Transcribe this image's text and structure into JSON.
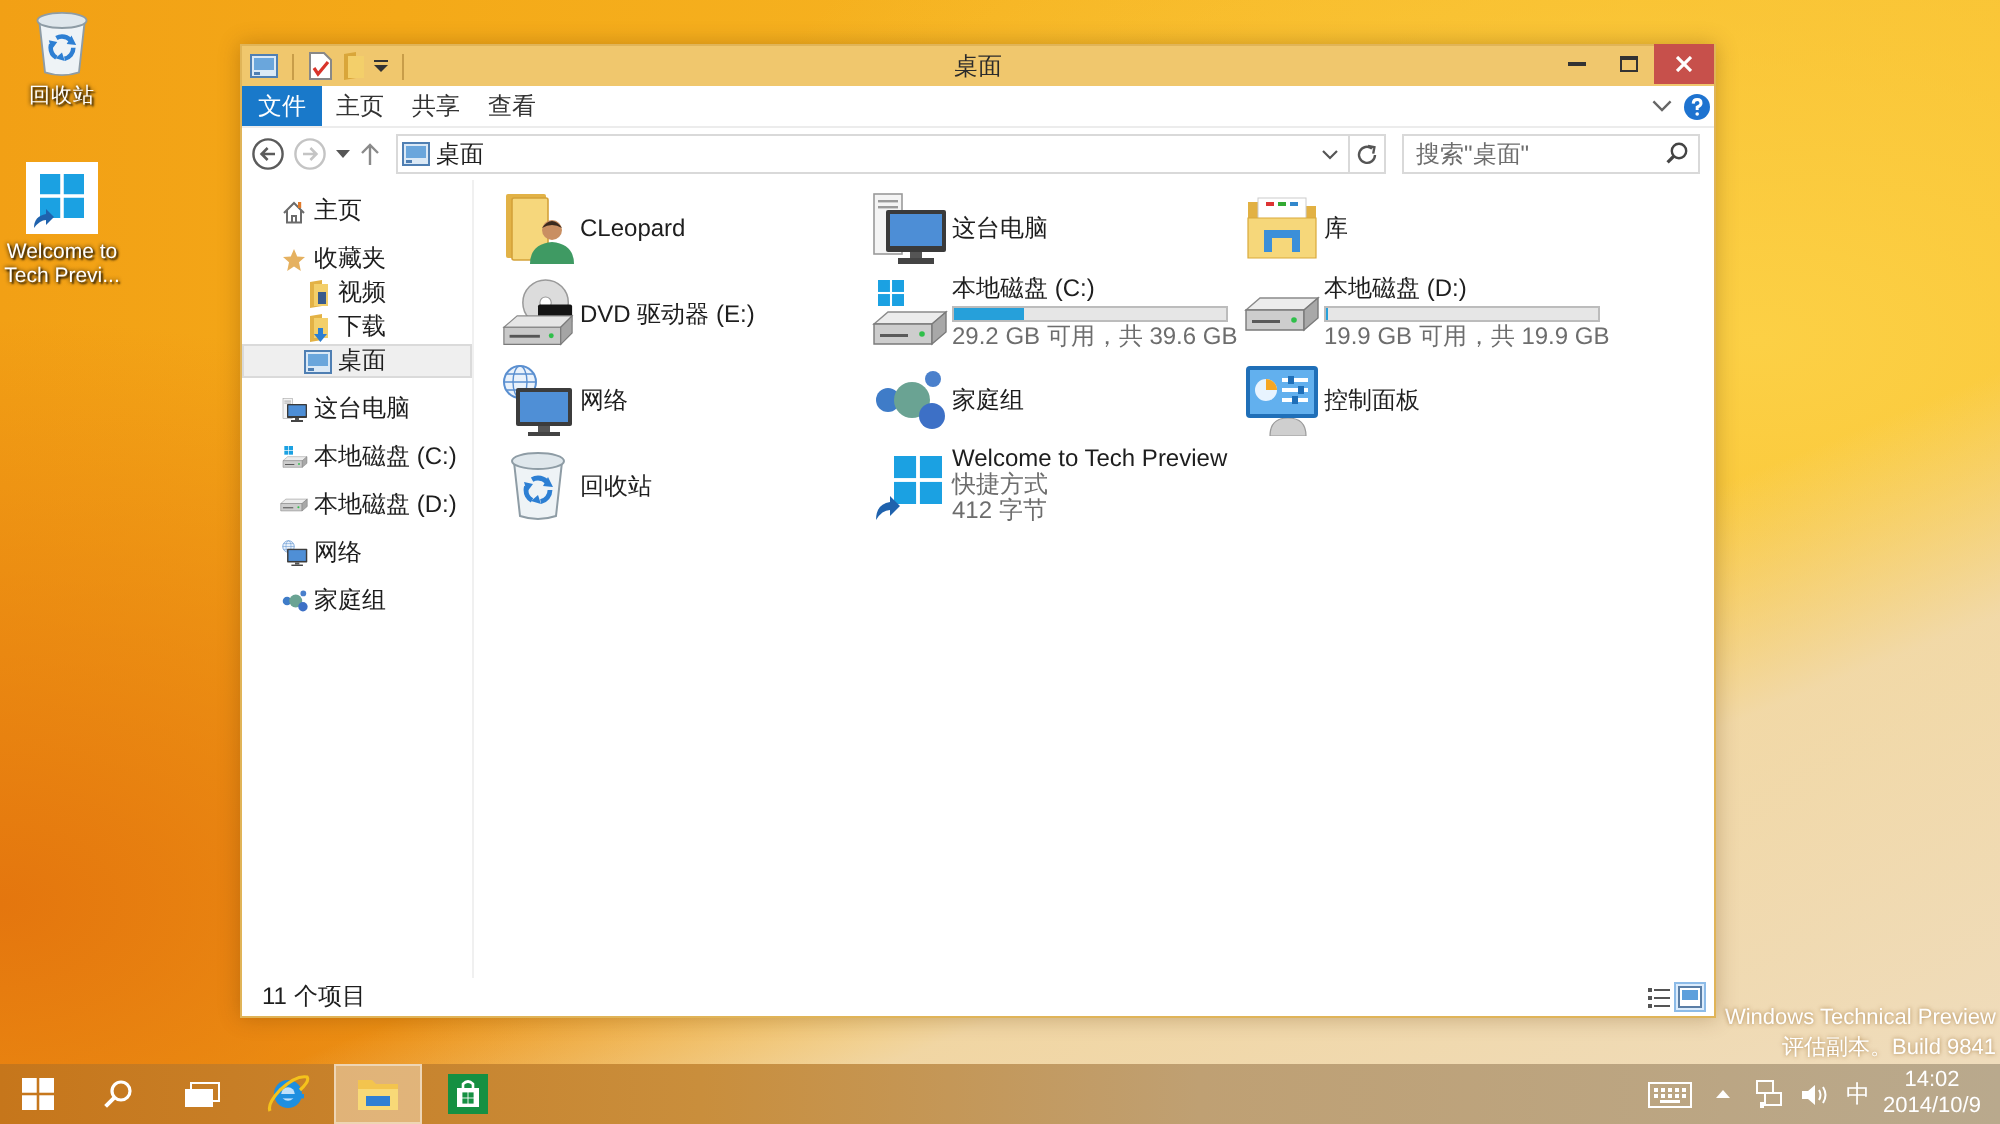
{
  "desktop": {
    "icons": [
      {
        "label": "回收站"
      },
      {
        "label": "Welcome to Tech Previ..."
      }
    ],
    "build_info": [
      "Windows Technical Preview",
      "评估副本。Build 9841"
    ]
  },
  "window": {
    "title": "桌面",
    "ribbon_tabs": [
      {
        "label": "文件",
        "kind": "menu"
      },
      {
        "label": "主页",
        "kind": "tab"
      },
      {
        "label": "共享",
        "kind": "tab"
      },
      {
        "label": "查看",
        "kind": "tab"
      }
    ],
    "address_bar": {
      "back": {
        "disabled": false
      },
      "forward": {
        "disabled": true
      },
      "path": "桌面"
    },
    "search": {
      "placeholder": "搜索\"桌面\""
    },
    "nav": {
      "items": [
        {
          "label": "主页",
          "selected": false
        },
        {
          "label": "收藏夹",
          "selected": false,
          "children": [
            {
              "label": "视频",
              "selected": false
            },
            {
              "label": "下载",
              "selected": false
            },
            {
              "label": "桌面",
              "selected": true
            }
          ]
        },
        {
          "label": "这台电脑",
          "selected": false
        },
        {
          "label": "本地磁盘 (C:)",
          "selected": false
        },
        {
          "label": "本地磁盘 (D:)",
          "selected": false
        },
        {
          "label": "网络",
          "selected": false
        },
        {
          "label": "家庭组",
          "selected": false
        }
      ]
    },
    "items": [
      {
        "kind": "plain",
        "name": "CLeopard"
      },
      {
        "kind": "plain",
        "name": "这台电脑"
      },
      {
        "kind": "plain",
        "name": "库"
      },
      {
        "kind": "plain",
        "name": "DVD 驱动器 (E:)"
      },
      {
        "kind": "drive",
        "name": "本地磁盘 (C:)",
        "level": 0.26,
        "free_space": "29.2 GB 可用，共 39.6 GB"
      },
      {
        "kind": "drive",
        "name": "本地磁盘 (D:)",
        "level": 0,
        "free_space": "19.9 GB 可用，共 19.9 GB"
      },
      {
        "kind": "plain",
        "name": "网络"
      },
      {
        "kind": "plain",
        "name": "家庭组"
      },
      {
        "kind": "plain",
        "name": "控制面板"
      },
      {
        "kind": "plain",
        "name": "回收站"
      },
      {
        "kind": "file",
        "name": "Welcome to Tech Preview",
        "details": [
          "快捷方式",
          "412 字节"
        ]
      }
    ],
    "status_bar": {
      "item_count": "11 个项目",
      "view_buttons": [
        {
          "selected": false
        },
        {
          "selected": true
        }
      ]
    }
  },
  "taskbar": {
    "apps": [
      {
        "selected": false
      },
      {
        "selected": true
      },
      {
        "selected": false
      }
    ],
    "tray": {
      "ime": "中",
      "time": "14:02",
      "date": "2014/10/9"
    }
  }
}
